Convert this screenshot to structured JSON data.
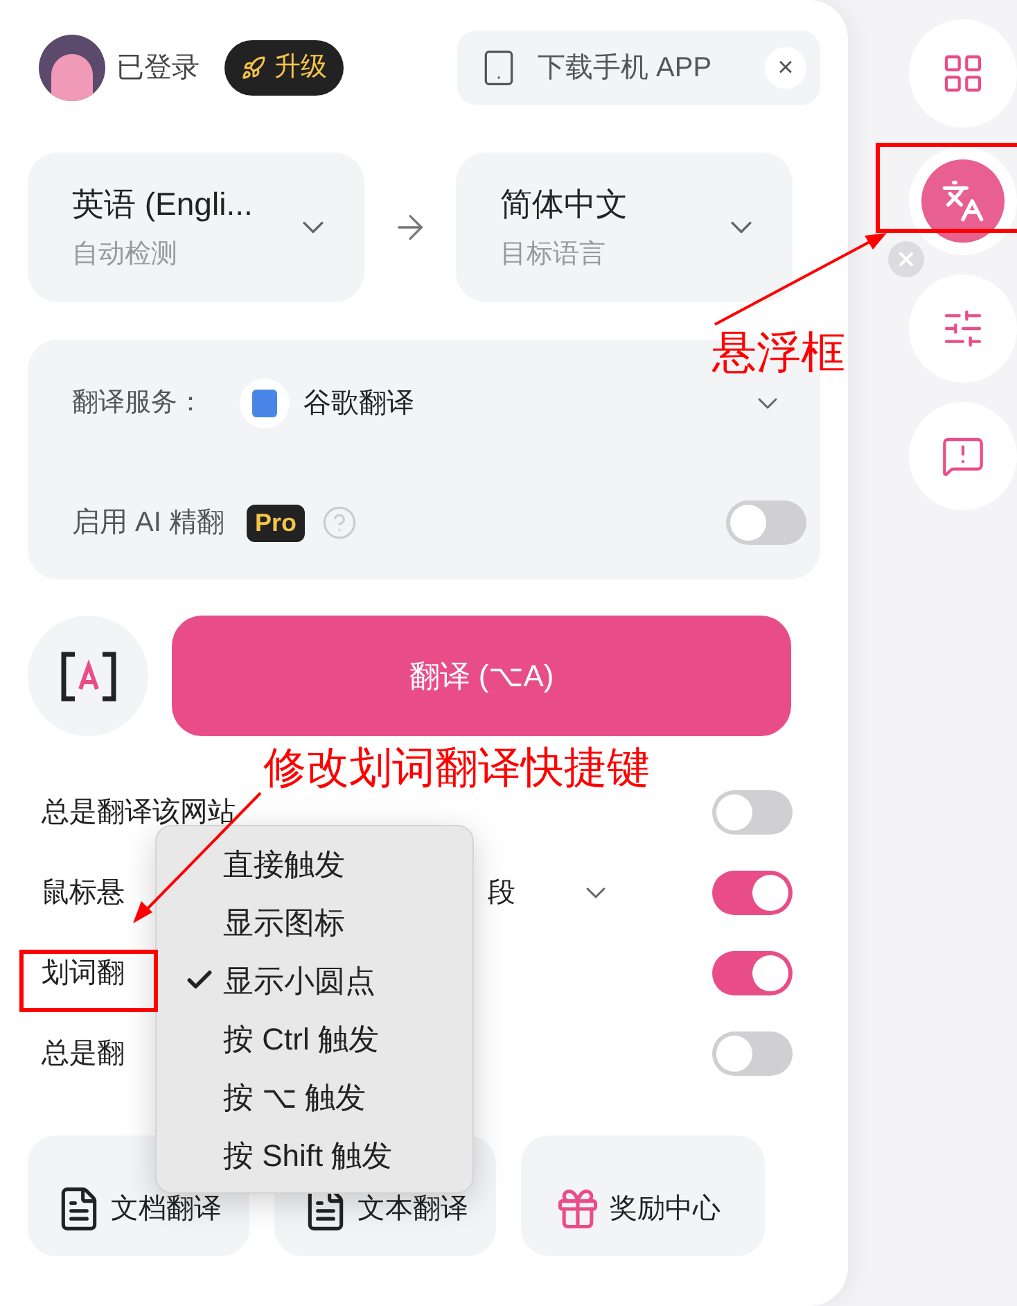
{
  "header": {
    "user_status": "已登录",
    "upgrade_button": "升级",
    "download_chip": {
      "label": "下载手机 APP",
      "close": "×"
    }
  },
  "language": {
    "source": {
      "name": "英语 (Engli...",
      "hint": "自动检测"
    },
    "target": {
      "name": "简体中文",
      "hint": "目标语言"
    }
  },
  "service": {
    "label": "翻译服务：",
    "value": "谷歌翻译",
    "ai": {
      "label": "启用 AI 精翻",
      "badge": "Pro",
      "on": false
    }
  },
  "translate_button": "翻译 (⌥A)",
  "settings": [
    {
      "label": "总是翻译该网站",
      "on": false
    },
    {
      "label": "鼠标悬",
      "suffix": "段",
      "on": true
    },
    {
      "label": "划词翻",
      "on": true
    },
    {
      "label": "总是翻",
      "on": false
    }
  ],
  "menu": {
    "items": [
      {
        "label": "直接触发",
        "selected": false
      },
      {
        "label": "显示图标",
        "selected": false
      },
      {
        "label": "显示小圆点",
        "selected": true
      },
      {
        "label": "按 Ctrl 触发",
        "selected": false
      },
      {
        "label": "按 ⌥ 触发",
        "selected": false
      },
      {
        "label": "按 Shift 触发",
        "selected": false
      }
    ]
  },
  "bottom_buttons": [
    {
      "label": "文档翻译",
      "kind": "doc"
    },
    {
      "label": "文本翻译",
      "kind": "text"
    },
    {
      "label": "奖励中心",
      "kind": "gift"
    }
  ],
  "side_buttons": [
    {
      "kind": "apps",
      "on": false
    },
    {
      "kind": "float",
      "on": true
    },
    {
      "kind": "settings",
      "on": false
    },
    {
      "kind": "feedback",
      "on": false
    }
  ],
  "annotations": [
    {
      "kind": "float",
      "text": "悬浮框"
    },
    {
      "kind": "shortcut",
      "text": "修改划词翻译快捷键"
    }
  ]
}
